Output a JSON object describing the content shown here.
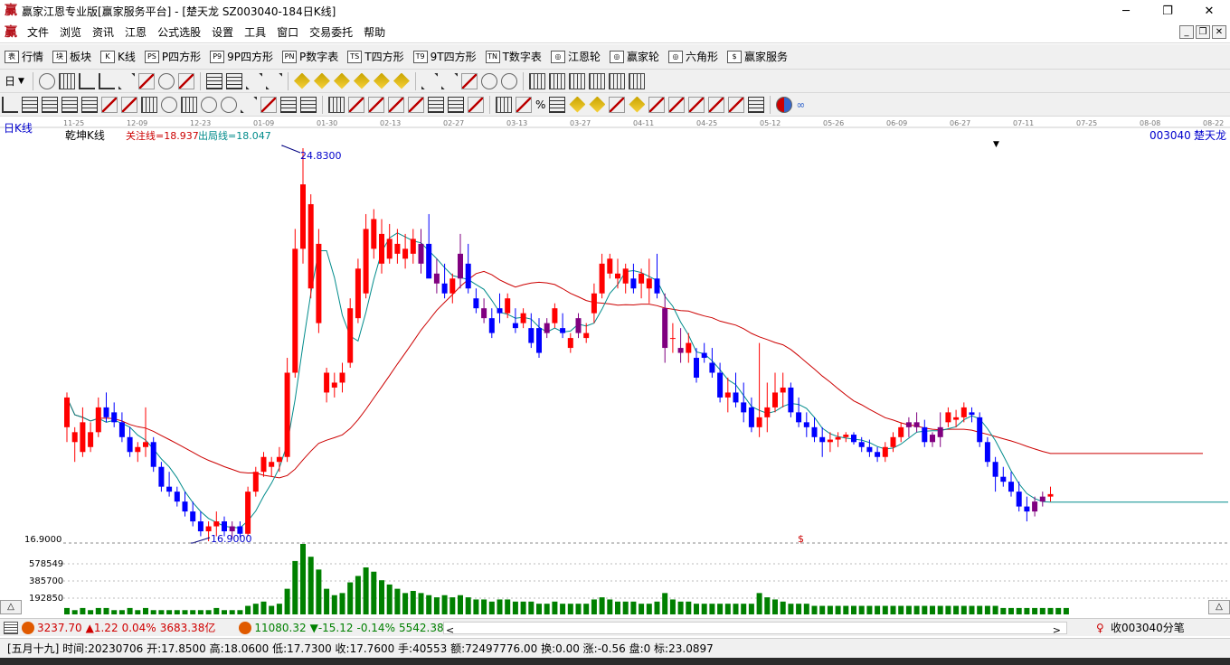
{
  "window": {
    "title": "赢家江恩专业版[赢家服务平台] - [楚天龙  SZ003040-184日K线]",
    "controls": [
      "─",
      "❐",
      "✕"
    ]
  },
  "menu": [
    "文件",
    "浏览",
    "资讯",
    "江恩",
    "公式选股",
    "设置",
    "工具",
    "窗口",
    "交易委托",
    "帮助"
  ],
  "toolbar1": [
    {
      "icon": "表",
      "label": "行情"
    },
    {
      "icon": "块",
      "label": "板块"
    },
    {
      "icon": "K",
      "label": "K线"
    },
    {
      "icon": "PS",
      "label": "P四方形"
    },
    {
      "icon": "P9",
      "label": "9P四方形"
    },
    {
      "icon": "PN",
      "label": "P数字表"
    },
    {
      "icon": "TS",
      "label": "T四方形"
    },
    {
      "icon": "T9",
      "label": "9T四方形"
    },
    {
      "icon": "TN",
      "label": "T数字表"
    },
    {
      "icon": "◎",
      "label": "江恩轮"
    },
    {
      "icon": "◎",
      "label": "赢家轮"
    },
    {
      "icon": "◎",
      "label": "六角形"
    },
    {
      "icon": "$",
      "label": "赢家服务"
    }
  ],
  "period_selector": "日",
  "chart": {
    "period_label": "日K线",
    "indicator_name": "乾坤K线",
    "attention_line": "关注线=18.937",
    "exit_line": "出局线=18.047",
    "stock_code": "003040",
    "stock_name": "楚天龙",
    "high_label": "24.8300",
    "low_label": "16.9000",
    "price_axis_label": "16.9000",
    "volume_axis_labels": [
      "578549",
      "385700",
      "192850"
    ],
    "dollar_marker": "$"
  },
  "time_axis": [
    "11-25",
    "12-09",
    "12-23",
    "01-09",
    "01-30",
    "02-13",
    "02-27",
    "03-13",
    "03-27",
    "04-11",
    "04-25",
    "05-12",
    "05-26",
    "06-09",
    "06-27",
    "07-11",
    "07-25",
    "08-08",
    "08-22"
  ],
  "chart_data": {
    "type": "candlestick",
    "title": "",
    "ohlc": [
      [
        19.2,
        19.9,
        18.9,
        19.8
      ],
      [
        18.9,
        19.2,
        18.5,
        19.1
      ],
      [
        18.7,
        19.6,
        18.6,
        19.3
      ],
      [
        18.8,
        19.3,
        18.7,
        19.1
      ],
      [
        19.1,
        19.8,
        19.0,
        19.6
      ],
      [
        19.6,
        19.9,
        19.3,
        19.4
      ],
      [
        19.5,
        19.7,
        19.2,
        19.3
      ],
      [
        19.3,
        19.5,
        18.9,
        19.0
      ],
      [
        19.0,
        19.2,
        18.6,
        18.7
      ],
      [
        18.7,
        18.9,
        18.5,
        18.8
      ],
      [
        18.8,
        19.6,
        18.6,
        18.9
      ],
      [
        18.9,
        19.0,
        18.3,
        18.4
      ],
      [
        18.4,
        18.5,
        17.9,
        18.0
      ],
      [
        18.0,
        18.3,
        17.8,
        17.9
      ],
      [
        17.9,
        18.0,
        17.6,
        17.7
      ],
      [
        17.7,
        17.9,
        17.4,
        17.5
      ],
      [
        17.5,
        17.7,
        17.2,
        17.3
      ],
      [
        17.3,
        17.5,
        17.0,
        17.1
      ],
      [
        17.1,
        17.3,
        16.9,
        17.2
      ],
      [
        17.2,
        17.5,
        17.0,
        17.3
      ],
      [
        17.3,
        17.4,
        17.0,
        17.1
      ],
      [
        17.1,
        17.3,
        16.95,
        17.2
      ],
      [
        17.2,
        17.3,
        16.98,
        17.05
      ],
      [
        17.05,
        18.0,
        17.0,
        17.9
      ],
      [
        17.9,
        18.4,
        17.8,
        18.3
      ],
      [
        18.3,
        18.7,
        18.2,
        18.6
      ],
      [
        18.4,
        18.6,
        18.2,
        18.5
      ],
      [
        18.5,
        18.8,
        18.3,
        18.6
      ],
      [
        18.6,
        20.6,
        18.5,
        20.3
      ],
      [
        20.3,
        23.2,
        20.2,
        22.8
      ],
      [
        22.8,
        24.83,
        22.5,
        24.1
      ],
      [
        22.0,
        23.9,
        21.8,
        23.7
      ],
      [
        21.3,
        23.2,
        21.1,
        22.9
      ],
      [
        19.9,
        20.4,
        19.7,
        20.3
      ],
      [
        20.0,
        20.3,
        19.8,
        20.1
      ],
      [
        20.1,
        20.5,
        19.9,
        20.3
      ],
      [
        20.5,
        21.8,
        20.4,
        21.6
      ],
      [
        21.4,
        22.6,
        21.3,
        22.4
      ],
      [
        21.9,
        23.5,
        21.8,
        23.2
      ],
      [
        22.8,
        23.6,
        22.6,
        23.4
      ],
      [
        22.5,
        23.4,
        22.3,
        23.1
      ],
      [
        22.6,
        23.3,
        22.5,
        23.0
      ],
      [
        22.7,
        23.2,
        22.5,
        22.9
      ],
      [
        22.6,
        23.1,
        22.4,
        22.8
      ],
      [
        22.7,
        23.2,
        22.5,
        23.0
      ],
      [
        22.5,
        23.2,
        22.3,
        22.9
      ],
      [
        22.9,
        23.5,
        22.6,
        22.2
      ],
      [
        22.3,
        22.6,
        21.9,
        22.1
      ],
      [
        22.1,
        22.5,
        21.8,
        21.9
      ],
      [
        21.9,
        22.3,
        21.7,
        22.2
      ],
      [
        22.2,
        23.1,
        22.0,
        22.7
      ],
      [
        22.5,
        22.9,
        21.9,
        22.0
      ],
      [
        21.8,
        22.0,
        21.5,
        21.6
      ],
      [
        21.6,
        21.8,
        21.3,
        21.4
      ],
      [
        21.4,
        21.6,
        21.0,
        21.1
      ],
      [
        21.6,
        21.9,
        21.3,
        21.5
      ],
      [
        21.5,
        21.9,
        21.4,
        21.8
      ],
      [
        21.3,
        21.6,
        21.1,
        21.2
      ],
      [
        21.3,
        21.6,
        21.2,
        21.5
      ],
      [
        21.2,
        21.5,
        20.8,
        20.9
      ],
      [
        21.2,
        21.4,
        20.6,
        20.7
      ],
      [
        21.1,
        21.4,
        21.0,
        21.3
      ],
      [
        21.3,
        21.7,
        21.2,
        21.6
      ],
      [
        21.2,
        21.5,
        21.0,
        21.1
      ],
      [
        20.8,
        21.1,
        20.7,
        21.0
      ],
      [
        21.1,
        21.5,
        21.0,
        21.4
      ],
      [
        21.0,
        21.3,
        20.9,
        21.1
      ],
      [
        21.5,
        22.1,
        21.3,
        21.9
      ],
      [
        21.9,
        22.7,
        21.8,
        22.5
      ],
      [
        22.3,
        22.7,
        22.2,
        22.6
      ],
      [
        22.2,
        22.6,
        22.0,
        22.3
      ],
      [
        22.1,
        22.5,
        21.9,
        22.4
      ],
      [
        22.2,
        22.5,
        21.9,
        22.0
      ],
      [
        22.1,
        22.4,
        21.8,
        22.3
      ],
      [
        22.0,
        22.6,
        21.7,
        22.2
      ],
      [
        22.2,
        22.7,
        21.8,
        21.9
      ],
      [
        21.6,
        21.9,
        20.5,
        20.8
      ],
      [
        21.0,
        21.3,
        20.7,
        21.0
      ],
      [
        20.8,
        21.2,
        20.5,
        20.7
      ],
      [
        20.7,
        21.1,
        20.5,
        20.9
      ],
      [
        20.6,
        20.8,
        20.1,
        20.2
      ],
      [
        20.7,
        20.9,
        20.5,
        20.6
      ],
      [
        20.5,
        20.8,
        20.2,
        20.3
      ],
      [
        20.3,
        20.5,
        19.7,
        19.8
      ],
      [
        19.8,
        20.2,
        19.5,
        19.9
      ],
      [
        19.9,
        20.3,
        19.6,
        19.7
      ],
      [
        19.7,
        20.1,
        19.3,
        19.5
      ],
      [
        19.6,
        19.8,
        19.1,
        19.2
      ],
      [
        19.2,
        20.9,
        19.0,
        19.4
      ],
      [
        19.4,
        20.1,
        19.1,
        19.6
      ],
      [
        19.6,
        20.3,
        19.5,
        19.9
      ],
      [
        19.9,
        20.3,
        19.6,
        20.0
      ],
      [
        20.0,
        20.1,
        19.4,
        19.5
      ],
      [
        19.5,
        19.8,
        19.2,
        19.3
      ],
      [
        19.3,
        19.5,
        19.0,
        19.2
      ],
      [
        19.2,
        19.4,
        18.9,
        19.0
      ],
      [
        19.0,
        19.2,
        18.6,
        18.9
      ],
      [
        18.9,
        19.1,
        18.7,
        18.95
      ],
      [
        18.95,
        19.1,
        18.8,
        19.0
      ],
      [
        19.0,
        19.1,
        18.9,
        19.05
      ],
      [
        19.05,
        19.1,
        18.85,
        18.9
      ],
      [
        18.9,
        19.0,
        18.7,
        18.8
      ],
      [
        18.8,
        18.95,
        18.6,
        18.7
      ],
      [
        18.7,
        18.8,
        18.5,
        18.6
      ],
      [
        18.6,
        18.9,
        18.5,
        18.8
      ],
      [
        18.8,
        19.1,
        18.7,
        19.0
      ],
      [
        19.0,
        19.3,
        18.9,
        19.2
      ],
      [
        19.2,
        19.4,
        19.0,
        19.3
      ],
      [
        19.3,
        19.5,
        19.1,
        19.2
      ],
      [
        19.2,
        19.35,
        18.8,
        18.9
      ],
      [
        18.9,
        19.1,
        18.8,
        19.05
      ],
      [
        19.0,
        19.5,
        18.8,
        19.2
      ],
      [
        19.3,
        19.6,
        19.2,
        19.5
      ],
      [
        19.35,
        19.55,
        19.2,
        19.4
      ],
      [
        19.4,
        19.7,
        19.3,
        19.6
      ],
      [
        19.5,
        19.6,
        19.3,
        19.45
      ],
      [
        19.4,
        19.5,
        18.8,
        18.9
      ],
      [
        18.9,
        19.0,
        18.4,
        18.5
      ],
      [
        18.5,
        18.6,
        17.9,
        18.2
      ],
      [
        18.2,
        18.4,
        18.0,
        18.1
      ],
      [
        18.1,
        18.3,
        17.8,
        17.9
      ],
      [
        17.9,
        18.1,
        17.5,
        17.6
      ],
      [
        17.6,
        17.8,
        17.3,
        17.5
      ],
      [
        17.5,
        17.8,
        17.4,
        17.7
      ],
      [
        17.7,
        17.9,
        17.6,
        17.8
      ],
      [
        17.8,
        18.0,
        17.7,
        17.85
      ]
    ],
    "ma_fast": "cyan",
    "ma_slow": "red",
    "high_marker": 24.83,
    "low_marker": 16.9,
    "volume": [
      3,
      2,
      3,
      2,
      3,
      3,
      2,
      2,
      3,
      2,
      3,
      2,
      2,
      2,
      2,
      2,
      2,
      2,
      2,
      3,
      2,
      2,
      2,
      4,
      5,
      6,
      4,
      5,
      12,
      25,
      33,
      27,
      21,
      12,
      9,
      10,
      15,
      18,
      22,
      20,
      16,
      14,
      12,
      10,
      11,
      10,
      9,
      8,
      9,
      8,
      9,
      8,
      7,
      7,
      6,
      7,
      7,
      6,
      6,
      6,
      5,
      5,
      6,
      5,
      5,
      5,
      5,
      7,
      8,
      7,
      6,
      6,
      6,
      5,
      5,
      6,
      10,
      7,
      6,
      6,
      5,
      5,
      5,
      5,
      5,
      5,
      5,
      5,
      10,
      8,
      7,
      6,
      5,
      5,
      5,
      4,
      4,
      4,
      4,
      4,
      4,
      4,
      4,
      4,
      4,
      4,
      4,
      4,
      4,
      4,
      4,
      4,
      4,
      4,
      4,
      4,
      4,
      4,
      4,
      3,
      3,
      3,
      3,
      3,
      3,
      3,
      3,
      3
    ],
    "volume_ylim": [
      0,
      578549
    ]
  },
  "status1": {
    "sh_index": "3237.70",
    "sh_change": "▲1.22",
    "sh_pct": "0.04%",
    "sh_amount": "3683.38亿",
    "sz_index": "11080.32",
    "sz_change": "▼-15.12",
    "sz_pct": "-0.14%",
    "sz_amount": "5542.38",
    "receive_text": "收003040分笔"
  },
  "status2": {
    "detail": "[五月十九] 时间:20230706 开:17.8500 高:18.0600 低:17.7300 收:17.7600 手:40553 额:72497776.00 换:0.00 涨:-0.56 盘:0 标:23.0897"
  },
  "colors": {
    "up": "#ff0000",
    "down": "#0000ff",
    "special": "#800080",
    "volume": "#008000",
    "ma_fast": "#008b8b",
    "ma_slow": "#cc0000"
  }
}
